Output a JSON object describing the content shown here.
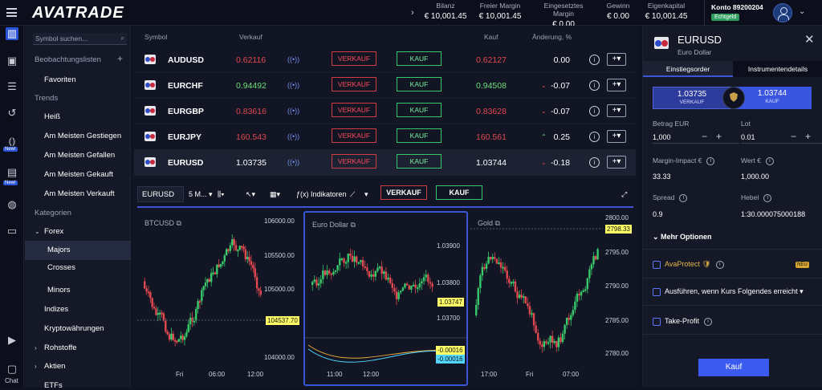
{
  "header": {
    "logo": "AVATRADE",
    "stats": [
      {
        "label": "Bilanz",
        "value": "€ 10,001.45"
      },
      {
        "label": "Freier Margin",
        "value": "€ 10,001.45"
      },
      {
        "label": "Eingesetztes Margin",
        "value": "€ 0.00"
      },
      {
        "label": "Gewinn",
        "value": "€ 0.00"
      },
      {
        "label": "Eigenkapital",
        "value": "€ 10,001.45"
      }
    ],
    "account": "Konto 89200204",
    "account_badge": "Echtgeld"
  },
  "rail": {
    "new_badge": "New!",
    "chat": "Chat"
  },
  "sidebar": {
    "search_placeholder": "Symbol suchen...",
    "watchlists": "Beobachtungslisten",
    "favorites": "Favoriten",
    "trends": "Trends",
    "trend_items": [
      "Heiß",
      "Am Meisten Gestiegen",
      "Am Meisten Gefallen",
      "Am Meisten Gekauft",
      "Am Meisten Verkauft"
    ],
    "categories": "Kategorien",
    "forex": "Forex",
    "forex_items": [
      "Majors",
      "Crosses",
      "Minors"
    ],
    "more": [
      "Indizes",
      "Kryptowährungen",
      "Rohstoffe",
      "Aktien",
      "ETFs"
    ]
  },
  "table": {
    "headers": {
      "symbol": "Symbol",
      "sell": "Verkauf",
      "buy": "Kauf",
      "change": "Änderung, %"
    },
    "sell_btn": "VERKAUF",
    "buy_btn": "KAUF",
    "rows": [
      {
        "symbol": "AUDUSD",
        "sell": "0.62116",
        "buy": "0.62127",
        "change": "0.00",
        "dir": "none",
        "sc": "red",
        "bc": "red"
      },
      {
        "symbol": "EURCHF",
        "sell": "0.94492",
        "buy": "0.94508",
        "change": "-0.07",
        "dir": "down",
        "sc": "grn",
        "bc": "grn"
      },
      {
        "symbol": "EURGBP",
        "sell": "0.83616",
        "buy": "0.83628",
        "change": "-0.07",
        "dir": "down",
        "sc": "red",
        "bc": "red"
      },
      {
        "symbol": "EURJPY",
        "sell": "160.543",
        "buy": "160.561",
        "change": "0.25",
        "dir": "up",
        "sc": "red",
        "bc": "red"
      },
      {
        "symbol": "EURUSD",
        "sell": "1.03735",
        "buy": "1.03744",
        "change": "-0.18",
        "dir": "down",
        "sc": "wht",
        "bc": "wht"
      }
    ]
  },
  "toolbar": {
    "symbol": "EURUSD",
    "interval": "5 M...",
    "indicators": "Indikatoren",
    "sell": "VERKAUF",
    "buy": "KAUF"
  },
  "charts": [
    {
      "title": "BTCUSD",
      "yticks": [
        "106000.00",
        "105500.00",
        "105000.00",
        "104000.00"
      ],
      "xticks": [
        "Fri",
        "06:00",
        "12:00"
      ],
      "price": "104537.70"
    },
    {
      "title": "Euro Dollar",
      "yticks": [
        "1.03900",
        "1.03800",
        "1.03700"
      ],
      "xticks": [
        "11:00",
        "12:00"
      ],
      "price": "1.03747",
      "ind1": "-0.00016",
      "ind2": "-0.00016"
    },
    {
      "title": "Gold",
      "yticks": [
        "2800.00",
        "2795.00",
        "2790.00",
        "2785.00",
        "2780.00"
      ],
      "xticks": [
        "17:00",
        "Fri",
        "07:00"
      ],
      "price": "2798.33"
    }
  ],
  "panel": {
    "symbol": "EURUSD",
    "name": "Euro Dollar",
    "tab1": "Einstiegsorder",
    "tab2": "Instrumentendetails",
    "sell_price": "1.03735",
    "sell_label": "VERKAUF",
    "buy_price": "1.03744",
    "buy_label": "KAUF",
    "amount_label": "Betrag EUR",
    "amount": "1,000",
    "lot_label": "Lot",
    "lot": "0.01",
    "margin_label": "Margin-Impact €",
    "margin": "33.33",
    "value_label": "Wert €",
    "value": "1,000.00",
    "spread_label": "Spread",
    "spread": "0.9",
    "leverage_label": "Hebel",
    "leverage": "1:30.000075000188",
    "more": "Mehr Optionen",
    "ava": "AvaProtect",
    "new": "NEU",
    "execute": "Ausführen, wenn Kurs Folgendes erreicht",
    "tp": "Take-Profit",
    "submit": "Kauf"
  }
}
